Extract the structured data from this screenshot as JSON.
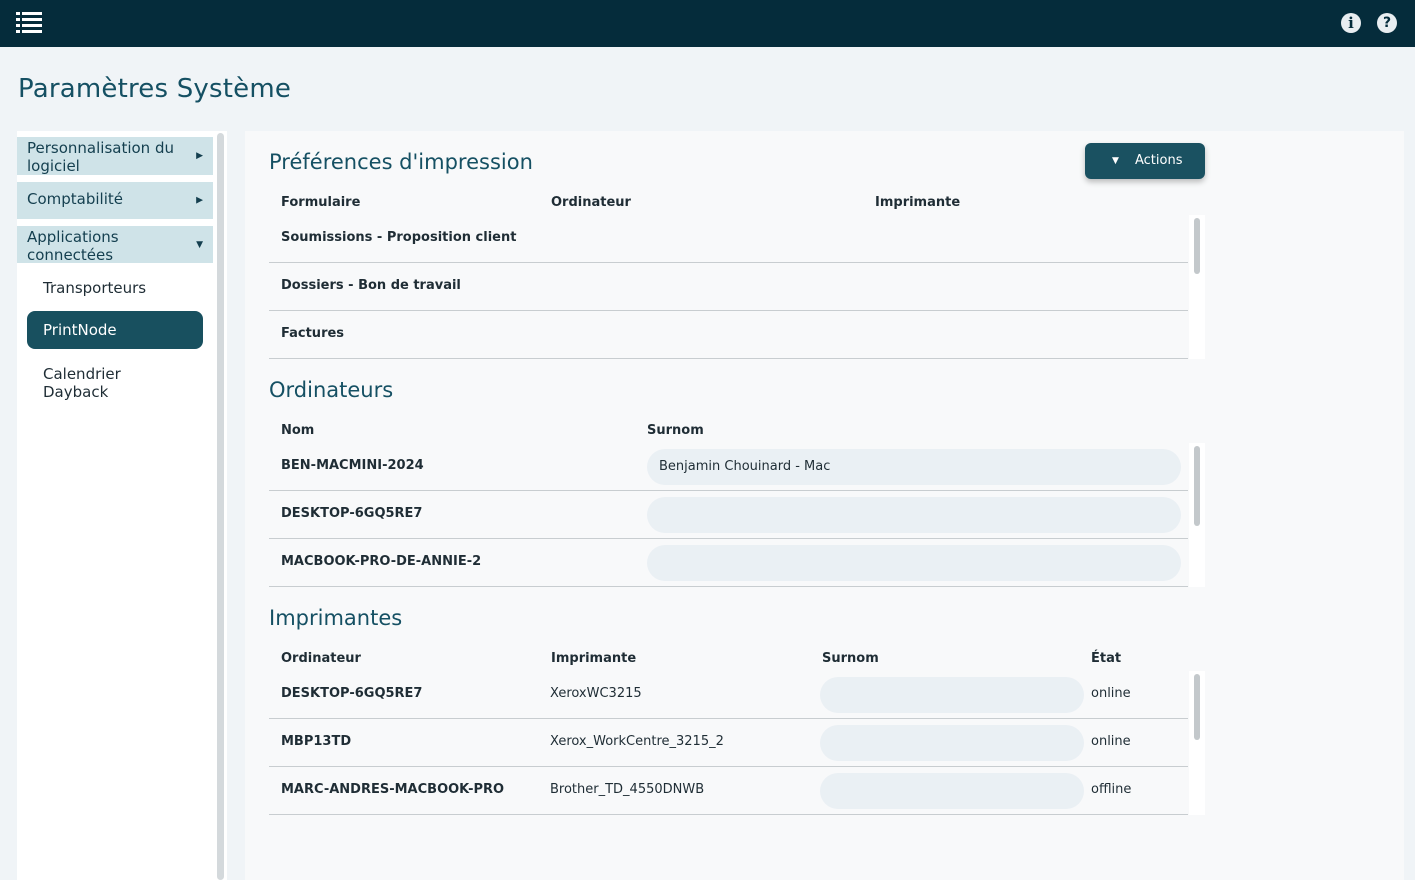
{
  "header": {
    "menu_icon": "hamburger-list-icon",
    "info_icon": "i",
    "help_icon": "?"
  },
  "page": {
    "title": "Paramètres Système"
  },
  "sidebar": {
    "categories": [
      {
        "label": "Personnalisation du logiciel",
        "state": "collapsed"
      },
      {
        "label": "Comptabilité",
        "state": "collapsed"
      },
      {
        "label": "Applications connectées",
        "state": "expanded"
      }
    ],
    "subitems": [
      {
        "label": "Transporteurs",
        "active": false
      },
      {
        "label": "PrintNode",
        "active": true
      },
      {
        "label": "Calendrier Dayback",
        "active": false
      }
    ]
  },
  "preferences": {
    "title": "Préférences d'impression",
    "actions_label": "Actions",
    "columns": [
      "Formulaire",
      "Ordinateur",
      "Imprimante"
    ],
    "rows": [
      {
        "form": "Soumissions - Proposition client",
        "computer": "",
        "printer": ""
      },
      {
        "form": "Dossiers - Bon de travail",
        "computer": "",
        "printer": ""
      },
      {
        "form": "Factures",
        "computer": "",
        "printer": ""
      }
    ]
  },
  "computers": {
    "title": "Ordinateurs",
    "columns": [
      "Nom",
      "Surnom"
    ],
    "rows": [
      {
        "name": "BEN-MACMINI-2024",
        "nickname": "Benjamin Chouinard - Mac"
      },
      {
        "name": "DESKTOP-6GQ5RE7",
        "nickname": ""
      },
      {
        "name": "MACBOOK-PRO-DE-ANNIE-2",
        "nickname": ""
      }
    ]
  },
  "printers": {
    "title": "Imprimantes",
    "columns": [
      "Ordinateur",
      "Imprimante",
      "Surnom",
      "État"
    ],
    "rows": [
      {
        "computer": "DESKTOP-6GQ5RE7",
        "printer": "XeroxWC3215",
        "nickname": "",
        "state": "online"
      },
      {
        "computer": "MBP13TD",
        "printer": "Xerox_WorkCentre_3215_2",
        "nickname": "",
        "state": "online"
      },
      {
        "computer": "MARC-ANDRES-MACBOOK-PRO",
        "printer": "Brother_TD_4550DNWB",
        "nickname": "",
        "state": "offline"
      }
    ]
  },
  "colors": {
    "topbar": "#052c3b",
    "accent": "#155063",
    "sidebar_category": "#cfe3e8",
    "active_item": "#18505f",
    "field_bg": "#eaf0f4"
  }
}
